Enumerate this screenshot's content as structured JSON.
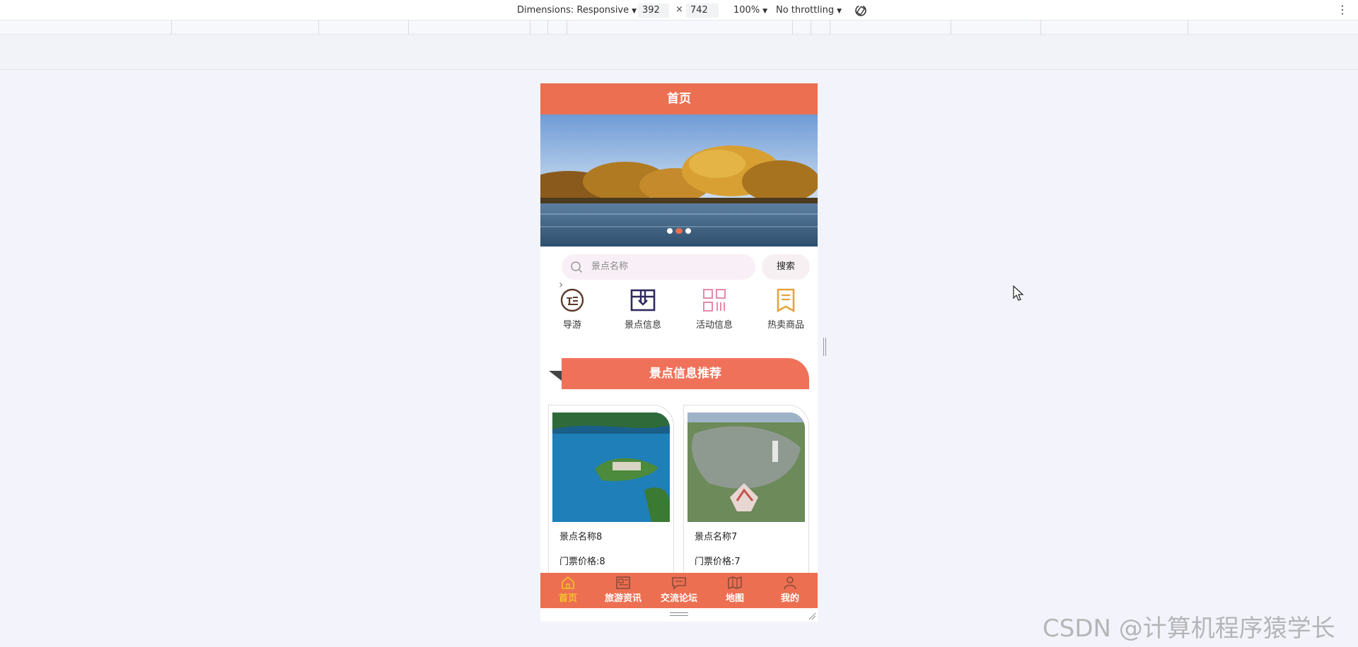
{
  "devtools": {
    "dimensions_label": "Dimensions: Responsive",
    "width": "392",
    "times": "×",
    "height": "742",
    "zoom": "100%",
    "throttle": "No throttling",
    "more": "⋮"
  },
  "app": {
    "header_title": "首页",
    "search_placeholder": "景点名称",
    "search_button": "搜索",
    "chevron": "›",
    "menu": [
      {
        "label": "导游",
        "icon": "guide-icon",
        "color": "#5b3a29"
      },
      {
        "label": "景点信息",
        "icon": "map-box-icon",
        "color": "#2e2a5e"
      },
      {
        "label": "活动信息",
        "icon": "grid-icon",
        "color": "#e58aa8"
      },
      {
        "label": "热卖商品",
        "icon": "document-icon",
        "color": "#e7a43a"
      }
    ],
    "section_title": "景点信息推荐",
    "cards": [
      {
        "name": "景点名称8",
        "price": "门票价格:8"
      },
      {
        "name": "景点名称7",
        "price": "门票价格:7"
      }
    ],
    "tabs": [
      {
        "label": "首页",
        "icon": "home-icon",
        "active": true
      },
      {
        "label": "旅游资讯",
        "icon": "news-icon",
        "active": false
      },
      {
        "label": "交流论坛",
        "icon": "chat-icon",
        "active": false
      },
      {
        "label": "地图",
        "icon": "map-icon",
        "active": false
      },
      {
        "label": "我的",
        "icon": "user-icon",
        "active": false
      }
    ],
    "colors": {
      "primary": "#ec6f51",
      "active_tab": "#f5c22b"
    }
  },
  "watermark": "CSDN @计算机程序猿学长"
}
